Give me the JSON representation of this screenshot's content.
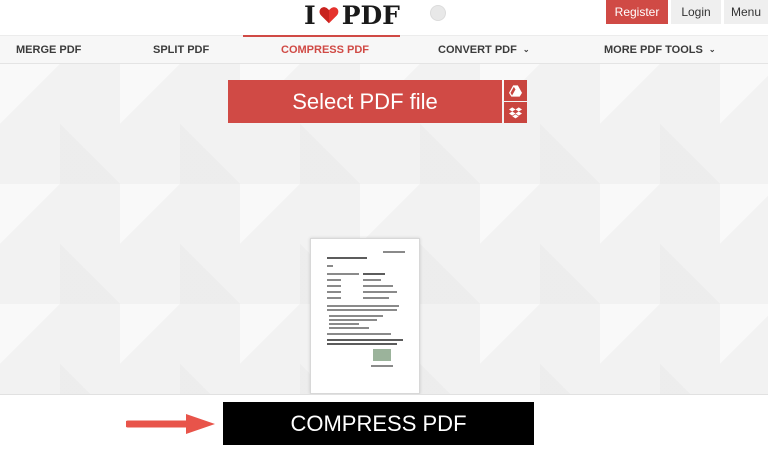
{
  "header": {
    "logo": {
      "left": "I",
      "right": "PDF"
    },
    "register_label": "Register",
    "login_label": "Login",
    "menu_label": "Menu"
  },
  "nav": {
    "items": [
      {
        "label": "MERGE PDF",
        "active": false,
        "has_dropdown": false
      },
      {
        "label": "SPLIT PDF",
        "active": false,
        "has_dropdown": false
      },
      {
        "label": "COMPRESS PDF",
        "active": true,
        "has_dropdown": false
      },
      {
        "label": "CONVERT PDF",
        "active": false,
        "has_dropdown": true
      },
      {
        "label": "MORE PDF TOOLS",
        "active": false,
        "has_dropdown": true
      }
    ]
  },
  "upload": {
    "select_label": "Select PDF file",
    "side_icons": [
      "google-drive-icon",
      "dropbox-icon"
    ]
  },
  "action": {
    "compress_label": "COMPRESS PDF"
  },
  "colors": {
    "accent": "#d04a45",
    "action_bg": "#000000",
    "arrow": "#e8544a"
  }
}
